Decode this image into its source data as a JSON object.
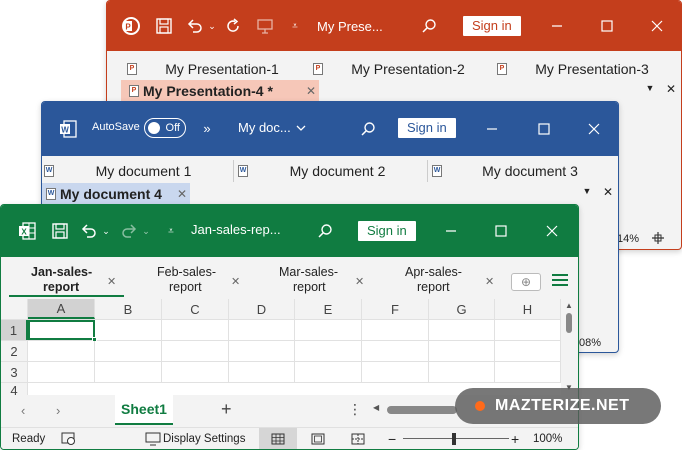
{
  "powerpoint": {
    "title": "My Prese...",
    "sign_in": "Sign in",
    "tabs": [
      "My Presentation-1",
      "My Presentation-2",
      "My Presentation-3"
    ],
    "active_tab": "My Presentation-4 *",
    "zoom": "14%",
    "accent": "#c43e1c"
  },
  "word": {
    "autosave_label": "AutoSave",
    "autosave_state": "Off",
    "title": "My doc...",
    "sign_in": "Sign in",
    "tabs": [
      "My document 1",
      "My document 2",
      "My document 3"
    ],
    "active_tab": "My document 4",
    "zoom": "08%",
    "accent": "#2b579a"
  },
  "excel": {
    "title": "Jan-sales-rep...",
    "sign_in": "Sign in",
    "tabs": [
      {
        "line1": "Jan-sales-",
        "line2": "report"
      },
      {
        "line1": "Feb-sales-",
        "line2": "report"
      },
      {
        "line1": "Mar-sales-",
        "line2": "report"
      },
      {
        "line1": "Apr-sales-",
        "line2": "report"
      }
    ],
    "columns": [
      "A",
      "B",
      "C",
      "D",
      "E",
      "F",
      "G",
      "H"
    ],
    "rows": [
      "1",
      "2",
      "3",
      "4"
    ],
    "sheet_tab": "Sheet1",
    "status": {
      "ready": "Ready",
      "display_settings": "Display Settings",
      "zoom": "100%"
    },
    "accent": "#107c41"
  },
  "watermark": "MAZTERIZE.NET"
}
